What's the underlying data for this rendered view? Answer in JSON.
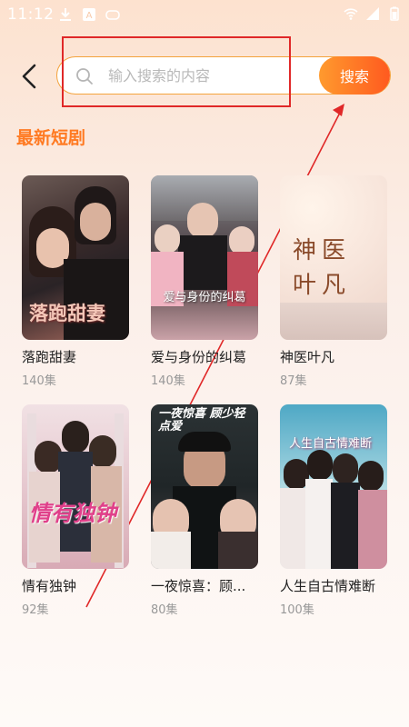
{
  "status_bar": {
    "time": "11:12"
  },
  "search": {
    "placeholder": "输入搜索的内容",
    "value": "",
    "button_label": "搜索"
  },
  "section": {
    "title": "最新短剧"
  },
  "colors": {
    "accent": "#ff7a22",
    "button_start": "#ff9a2e",
    "button_end": "#ff5a1f",
    "annotation": "#e02828"
  },
  "dramas": [
    {
      "title": "落跑甜妻",
      "episodes": "140集",
      "cover_text": "落跑甜妻"
    },
    {
      "title": "爱与身份的纠葛",
      "episodes": "140集",
      "cover_text": "爱与身份的纠葛"
    },
    {
      "title": "神医叶凡",
      "episodes": "87集",
      "cover_text": "神医叶凡"
    },
    {
      "title": "情有独钟",
      "episodes": "92集",
      "cover_text": "情有独钟"
    },
    {
      "title": "一夜惊喜：顾...",
      "episodes": "80集",
      "cover_text": "一夜惊喜 顾少轻点爱"
    },
    {
      "title": "人生自古情难断",
      "episodes": "100集",
      "cover_text": "人生自古情难断"
    }
  ]
}
